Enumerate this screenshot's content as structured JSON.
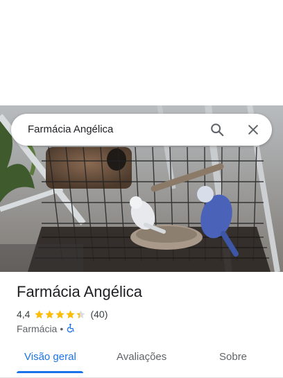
{
  "search": {
    "query": "Farmácia Angélica"
  },
  "place": {
    "name": "Farmácia Angélica",
    "rating": "4,4",
    "rating_value": 4.4,
    "review_count": "(40)",
    "category": "Farmácia",
    "separator": "•"
  },
  "tabs": [
    {
      "label": "Visão geral",
      "active": true
    },
    {
      "label": "Avaliações",
      "active": false
    },
    {
      "label": "Sobre",
      "active": false
    }
  ],
  "colors": {
    "accent": "#1a73e8",
    "star": "#fbbc04",
    "accessibility": "#1a73e8"
  },
  "icons": {
    "search": "search-icon",
    "close": "close-icon",
    "accessibility": "wheelchair-icon"
  }
}
